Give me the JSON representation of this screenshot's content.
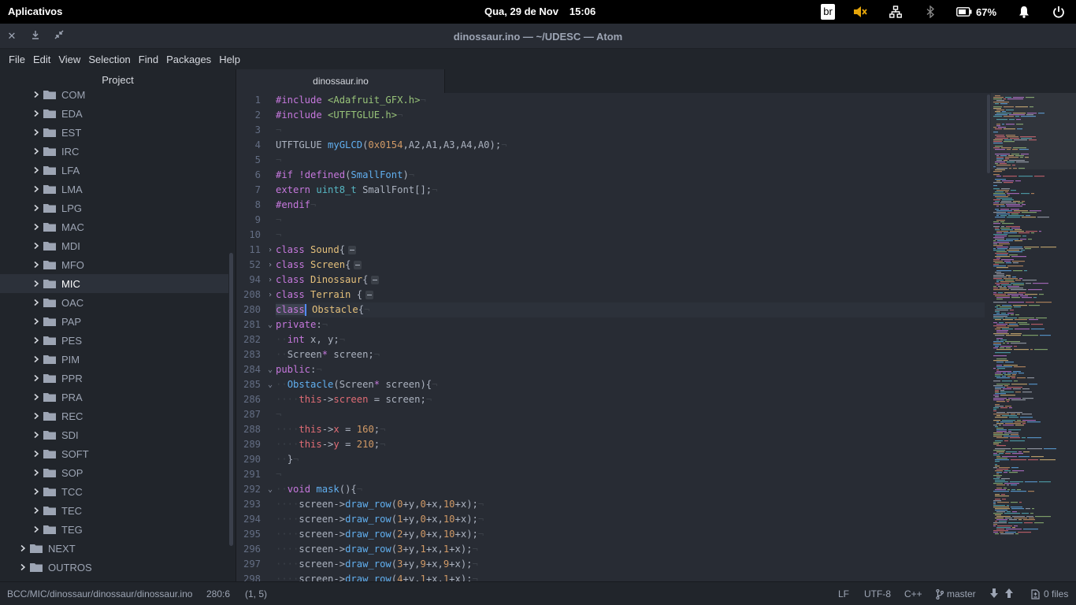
{
  "system_bar": {
    "apps_label": "Aplicativos",
    "date": "Qua, 29 de Nov",
    "time": "15:06",
    "keyboard_layout": "br",
    "battery_percent": "67%",
    "icons": [
      "muted-speaker-icon",
      "network-icon",
      "bluetooth-icon",
      "battery-icon",
      "notification-bell-icon",
      "power-icon"
    ]
  },
  "window": {
    "title": "dinossaur.ino — ~/UDESC — Atom",
    "buttons": [
      "close-icon",
      "minimize-icon",
      "restore-icon"
    ]
  },
  "menu": [
    "File",
    "Edit",
    "View",
    "Selection",
    "Find",
    "Packages",
    "Help"
  ],
  "tree": {
    "title": "Project",
    "items": [
      {
        "label": "COM",
        "depth": 1
      },
      {
        "label": "EDA",
        "depth": 1
      },
      {
        "label": "EST",
        "depth": 1
      },
      {
        "label": "IRC",
        "depth": 1
      },
      {
        "label": "LFA",
        "depth": 1
      },
      {
        "label": "LMA",
        "depth": 1
      },
      {
        "label": "LPG",
        "depth": 1
      },
      {
        "label": "MAC",
        "depth": 1
      },
      {
        "label": "MDI",
        "depth": 1
      },
      {
        "label": "MFO",
        "depth": 1
      },
      {
        "label": "MIC",
        "depth": 1,
        "selected": true
      },
      {
        "label": "OAC",
        "depth": 1
      },
      {
        "label": "PAP",
        "depth": 1
      },
      {
        "label": "PES",
        "depth": 1
      },
      {
        "label": "PIM",
        "depth": 1
      },
      {
        "label": "PPR",
        "depth": 1
      },
      {
        "label": "PRA",
        "depth": 1
      },
      {
        "label": "REC",
        "depth": 1
      },
      {
        "label": "SDI",
        "depth": 1
      },
      {
        "label": "SOFT",
        "depth": 1
      },
      {
        "label": "SOP",
        "depth": 1
      },
      {
        "label": "TCC",
        "depth": 1
      },
      {
        "label": "TEC",
        "depth": 1
      },
      {
        "label": "TEG",
        "depth": 1
      },
      {
        "label": "NEXT",
        "depth": 0
      },
      {
        "label": "OUTROS",
        "depth": 0
      }
    ]
  },
  "editor": {
    "tab_label": "dinossaur.ino",
    "lines": [
      {
        "n": "1",
        "html": "<span class=\"kw\">#include</span> <span class=\"str\">&lt;Adafruit_GFX.h&gt;</span><span class=\"ind\">¬</span>"
      },
      {
        "n": "2",
        "html": "<span class=\"kw\">#include</span> <span class=\"str\">&lt;UTFTGLUE.h&gt;</span><span class=\"ind\">¬</span>"
      },
      {
        "n": "3",
        "html": "<span class=\"ind\">¬</span>"
      },
      {
        "n": "4",
        "html": "UTFTGLUE <span class=\"fn\">myGLCD</span>(<span class=\"num\">0x0154</span>,A2,A1,A3,A4,A0);<span class=\"ind\">¬</span>"
      },
      {
        "n": "5",
        "html": "<span class=\"ind\">¬</span>"
      },
      {
        "n": "6",
        "html": "<span class=\"kw\">#if</span> <span class=\"kw\">!defined</span>(<span class=\"fn\">SmallFont</span>)<span class=\"ind\">¬</span>"
      },
      {
        "n": "7",
        "html": "<span class=\"kw\">extern</span> <span class=\"ty\">uint8_t</span> SmallFont[];<span class=\"ind\">¬</span>"
      },
      {
        "n": "8",
        "html": "<span class=\"kw\">#endif</span><span class=\"ind\">¬</span>"
      },
      {
        "n": "9",
        "html": "<span class=\"ind\">¬</span>"
      },
      {
        "n": "10",
        "html": "<span class=\"ind\">¬</span>"
      },
      {
        "n": "11",
        "fold": "›",
        "html": "<span class=\"kw\">class</span> <span class=\"cls\">Sound</span>{<span class=\"ell\"></span>"
      },
      {
        "n": "52",
        "fold": "›",
        "html": "<span class=\"kw\">class</span> <span class=\"cls\">Screen</span>{<span class=\"ell\"></span>"
      },
      {
        "n": "94",
        "fold": "›",
        "html": "<span class=\"kw\">class</span> <span class=\"cls\">Dinossaur</span>{<span class=\"ell\"></span>"
      },
      {
        "n": "208",
        "fold": "›",
        "html": "<span class=\"kw\">class</span> <span class=\"cls\">Terrain</span> {<span class=\"ell\"></span>"
      },
      {
        "n": "280",
        "cursor": true,
        "html": "<span class=\"kw sel\">class</span><span class=\"caret\"></span> <span class=\"cls\">Obstacle</span>{<span class=\"ind\">¬</span>"
      },
      {
        "n": "281",
        "fold": "⌄",
        "html": "<span class=\"kw\">private</span>:<span class=\"ind\">¬</span>"
      },
      {
        "n": "282",
        "html": "<span class=\"ind\">··</span><span class=\"kw\">int</span> x, y;<span class=\"ind\">¬</span>"
      },
      {
        "n": "283",
        "html": "<span class=\"ind\">··</span>Screen<span class=\"kw\">*</span> screen;<span class=\"ind\">¬</span>"
      },
      {
        "n": "284",
        "fold": "⌄",
        "html": "<span class=\"kw\">public</span>:<span class=\"ind\">¬</span>"
      },
      {
        "n": "285",
        "fold": "⌄",
        "html": "<span class=\"ind\">··</span><span class=\"fn\">Obstacle</span>(Screen<span class=\"kw\">*</span> screen){<span class=\"ind\">¬</span>"
      },
      {
        "n": "286",
        "html": "<span class=\"ind\">····</span><span class=\"var\">this</span>-&gt;<span class=\"var\">screen</span> = screen;<span class=\"ind\">¬</span>"
      },
      {
        "n": "287",
        "html": "<span class=\"ind\">¬</span>"
      },
      {
        "n": "288",
        "html": "<span class=\"ind\">····</span><span class=\"var\">this</span>-&gt;<span class=\"var\">x</span> = <span class=\"num\">160</span>;<span class=\"ind\">¬</span>"
      },
      {
        "n": "289",
        "html": "<span class=\"ind\">····</span><span class=\"var\">this</span>-&gt;<span class=\"var\">y</span> = <span class=\"num\">210</span>;<span class=\"ind\">¬</span>"
      },
      {
        "n": "290",
        "html": "<span class=\"ind\">··</span>}<span class=\"ind\">¬</span>"
      },
      {
        "n": "291",
        "html": "<span class=\"ind\">¬</span>"
      },
      {
        "n": "292",
        "fold": "⌄",
        "html": "<span class=\"ind\">··</span><span class=\"kw\">void</span> <span class=\"fn\">mask</span>(){<span class=\"ind\">¬</span>"
      },
      {
        "n": "293",
        "html": "<span class=\"ind\">····</span>screen-&gt;<span class=\"fn\">draw_row</span>(<span class=\"num\">0</span>+y,<span class=\"num\">0</span>+x,<span class=\"num\">10</span>+x);<span class=\"ind\">¬</span>"
      },
      {
        "n": "294",
        "html": "<span class=\"ind\">····</span>screen-&gt;<span class=\"fn\">draw_row</span>(<span class=\"num\">1</span>+y,<span class=\"num\">0</span>+x,<span class=\"num\">10</span>+x);<span class=\"ind\">¬</span>"
      },
      {
        "n": "295",
        "html": "<span class=\"ind\">····</span>screen-&gt;<span class=\"fn\">draw_row</span>(<span class=\"num\">2</span>+y,<span class=\"num\">0</span>+x,<span class=\"num\">10</span>+x);<span class=\"ind\">¬</span>"
      },
      {
        "n": "296",
        "html": "<span class=\"ind\">····</span>screen-&gt;<span class=\"fn\">draw_row</span>(<span class=\"num\">3</span>+y,<span class=\"num\">1</span>+x,<span class=\"num\">1</span>+x);<span class=\"ind\">¬</span>"
      },
      {
        "n": "297",
        "html": "<span class=\"ind\">····</span>screen-&gt;<span class=\"fn\">draw_row</span>(<span class=\"num\">3</span>+y,<span class=\"num\">9</span>+x,<span class=\"num\">9</span>+x);<span class=\"ind\">¬</span>"
      },
      {
        "n": "298",
        "html": "<span class=\"ind\">····</span>screen-&gt;<span class=\"fn\">draw_row</span>(<span class=\"num\">4</span>+y,<span class=\"num\">1</span>+x,<span class=\"num\">1</span>+x);<span class=\"ind\">¬</span>"
      }
    ]
  },
  "status": {
    "path": "BCC/MIC/dinossaur/dinossaur/dinossaur.ino",
    "cursor": "280:6",
    "selection": "(1, 5)",
    "line_ending": "LF",
    "encoding": "UTF-8",
    "grammar": "C++",
    "branch": "master",
    "files": "0 files"
  },
  "colors": {
    "keyword": "#c678dd",
    "string": "#98c379",
    "function": "#61afef",
    "number": "#d19a66",
    "class": "#e5c07b",
    "variable": "#e06c75",
    "type": "#56b6c2"
  }
}
